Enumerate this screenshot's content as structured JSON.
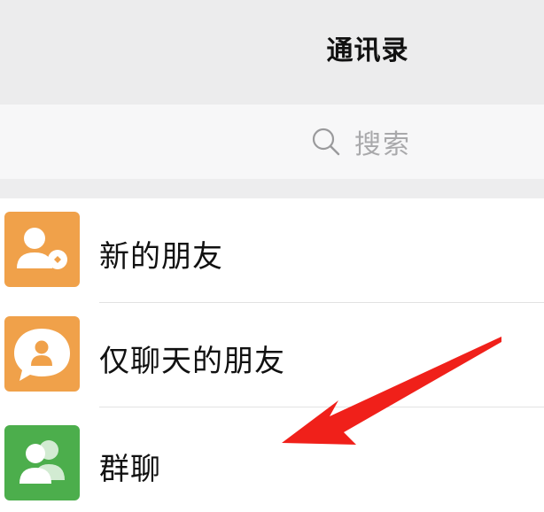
{
  "header": {
    "title": "通讯录"
  },
  "search": {
    "placeholder": "搜索"
  },
  "contacts": {
    "items": [
      {
        "label": "新的朋友",
        "icon": "new-friend-icon",
        "color": "#f0a14a"
      },
      {
        "label": "仅聊天的朋友",
        "icon": "chat-only-friend-icon",
        "color": "#f0a14a"
      },
      {
        "label": "群聊",
        "icon": "group-chat-icon",
        "color": "#4cae4c"
      }
    ]
  },
  "annotation": {
    "icon": "red-arrow-icon",
    "color": "#f0201a"
  },
  "colors": {
    "header_bg": "#ececed",
    "orange": "#f0a14a",
    "green": "#4cae4c"
  }
}
